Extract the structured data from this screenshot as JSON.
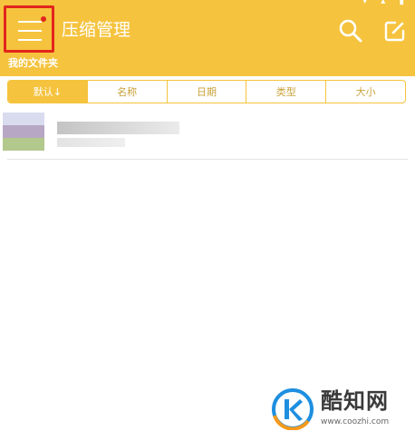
{
  "colors": {
    "accent": "#f5c33e",
    "highlight": "#e2261c",
    "header_text": "#ffffff"
  },
  "header": {
    "title": "压缩管理",
    "menu_icon": "hamburger-menu-icon",
    "search_icon": "search-icon",
    "edit_icon": "edit-icon"
  },
  "breadcrumb": "我的文件夹",
  "sort_tabs": [
    {
      "label": "默认↓",
      "selected": true
    },
    {
      "label": "名称",
      "selected": false
    },
    {
      "label": "日期",
      "selected": false
    },
    {
      "label": "类型",
      "selected": false
    },
    {
      "label": "大小",
      "selected": false
    }
  ],
  "watermark": {
    "name": "酷知网",
    "url": "www.coozhi.com"
  }
}
